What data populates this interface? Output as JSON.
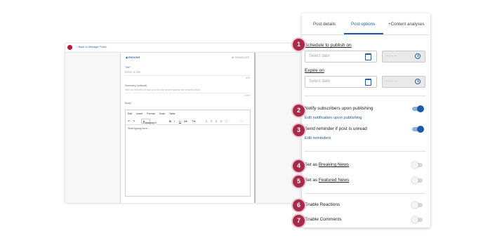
{
  "app": {
    "back_link": "Back to Manage Posts",
    "language": "ENGLISH",
    "translate": "TRANSLATE",
    "title_label": "Title*",
    "title_placeholder": "Enter a title",
    "title_count": "0/95",
    "summary_label": "Summary (optional)",
    "summary_placeholder": "Give an overview of your post to help people quickly see what it's about",
    "summary_count": "0/250",
    "body_label": "Body*",
    "editor_menu": [
      "Edit",
      "Insert",
      "Format",
      "Tools",
      "Table"
    ],
    "format_select": "Paragraph",
    "body_placeholder": "Start typing here..."
  },
  "panel": {
    "tabs": [
      {
        "label": "Post details",
        "active": false
      },
      {
        "label": "Post options",
        "active": true
      },
      {
        "label": "+Content analyses",
        "active": false
      }
    ],
    "schedule_title": "Schedule to publish on",
    "expire_title": "Expire on",
    "date_placeholder": "Select date",
    "time_placeholder": "--:-- --",
    "options": [
      {
        "number": "2",
        "label": "Notify subscribers upon publishing",
        "link": "Edit notification upon publishing",
        "on": true
      },
      {
        "number": "3",
        "label": "Send reminder if post is unread",
        "link": "Edit reminders",
        "on": true
      },
      {
        "number": "4",
        "label_prefix": "Set as",
        "label_link": "Breaking News",
        "on": false
      },
      {
        "number": "5",
        "label_prefix": "Set as",
        "label_link": "Featured News",
        "on": false
      },
      {
        "number": "6",
        "label": "Enable Reactions",
        "on": false
      },
      {
        "number": "7",
        "label": "Enable Comments",
        "on": false
      }
    ]
  },
  "callouts": [
    "1",
    "2",
    "3",
    "4",
    "5",
    "6",
    "7"
  ],
  "colors": {
    "accent": "#1e5aa8",
    "badge": "#a8294a",
    "toggle_on": "#1e5aa8",
    "toggle_off": "#d6d6d6"
  },
  "icons": [
    "back-arrow-icon",
    "globe-icon",
    "translate-icon",
    "calendar-icon",
    "clock-icon",
    "undo-icon",
    "redo-icon",
    "bold-icon",
    "italic-icon",
    "underline-icon"
  ]
}
